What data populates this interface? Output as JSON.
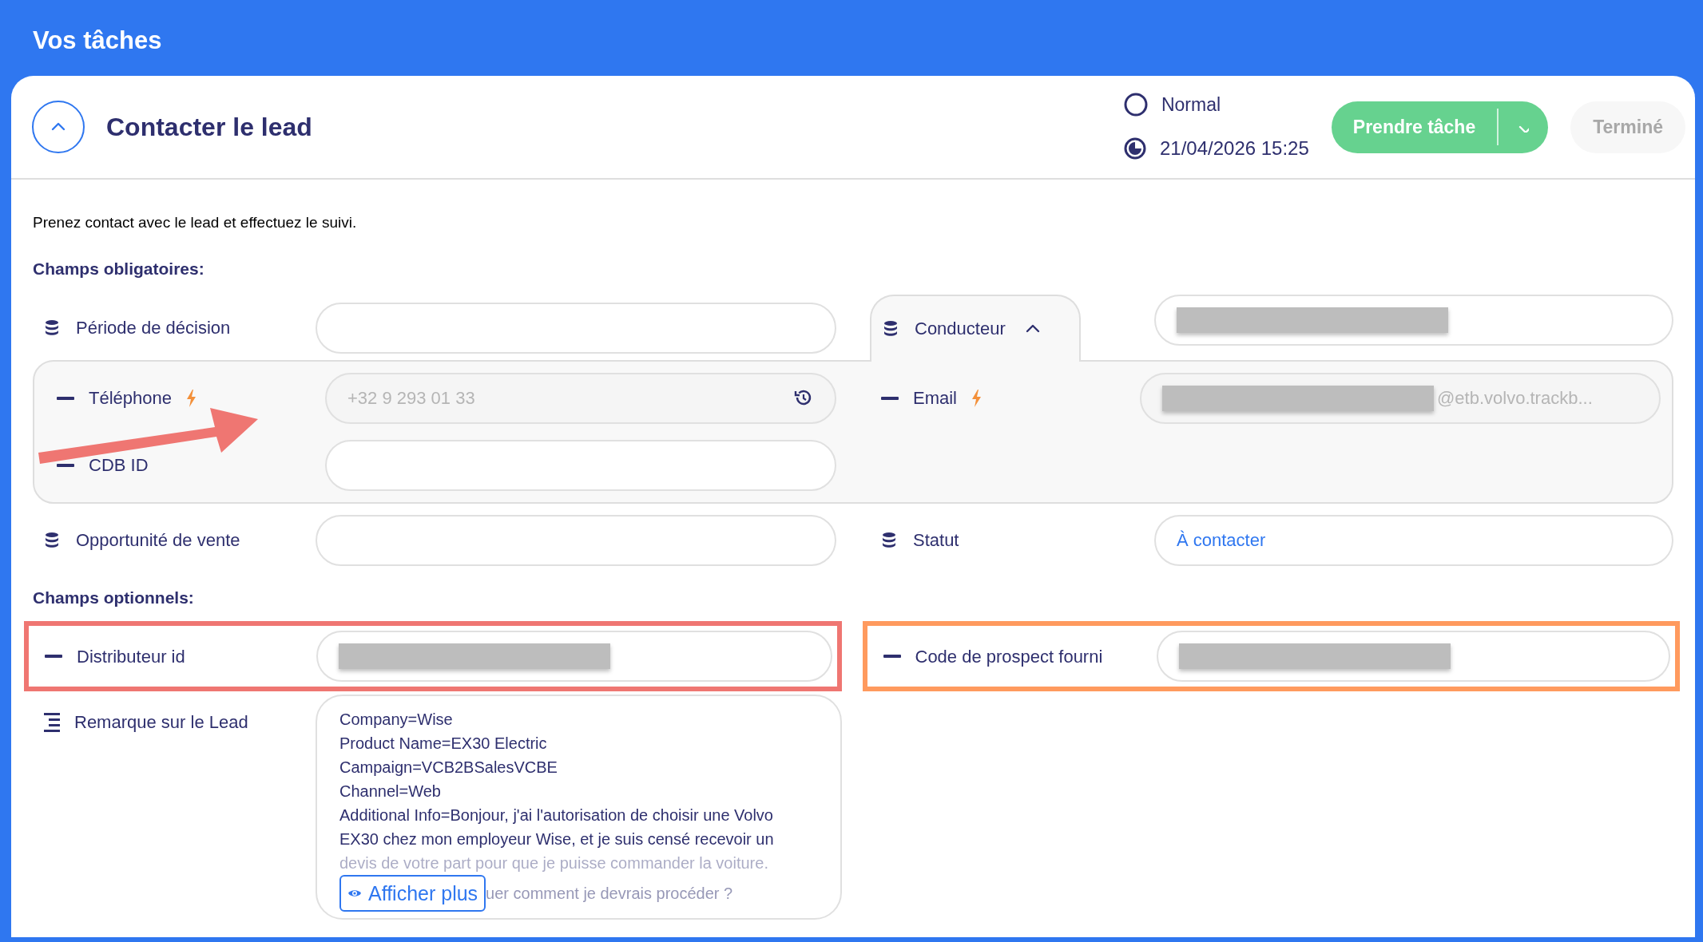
{
  "header": {
    "title": "Vos tâches"
  },
  "task": {
    "title": "Contacter le lead",
    "expanded": true,
    "priority": "Normal",
    "due": "21/04/2026 15:25",
    "primary_button": "Prendre tâche",
    "done_button": {
      "label": "Terminé",
      "disabled": true
    }
  },
  "description": "Prenez contact avec le lead et effectuez le suivi.",
  "required": {
    "title": "Champs obligatoires:",
    "rows": [
      {
        "kind": "pair",
        "left": {
          "kind": "linked",
          "label": "Période de décision"
        },
        "right": {
          "kind": "linked",
          "label": "Conducteur",
          "expanded": true,
          "redacted": true
        }
      },
      {
        "kind": "group",
        "left": [
          {
            "kind": "sub",
            "label": "Téléphone",
            "lightning": true,
            "readonly": true,
            "value": "+32 9 293 01 33",
            "history": true
          },
          {
            "kind": "sub",
            "label": "CDB ID"
          }
        ],
        "right": [
          {
            "kind": "sub",
            "label": "Email",
            "lightning": true,
            "readonly": true,
            "redacted": true,
            "value": "@etb.volvo.trackb..."
          }
        ]
      },
      {
        "kind": "pair",
        "left": {
          "kind": "linked",
          "label": "Opportunité de vente"
        },
        "right": {
          "kind": "linked",
          "label": "Statut",
          "value": "À contacter",
          "link": true
        }
      }
    ]
  },
  "optional": {
    "title": "Champs optionnels:",
    "rows": [
      {
        "kind": "pair",
        "left": {
          "kind": "sub",
          "label": "Distributeur id",
          "redacted": true,
          "color": "#ef7672"
        },
        "right": {
          "kind": "sub",
          "label": "Code de prospect fourni",
          "redacted": true,
          "color": "#ff9a5e"
        }
      },
      {
        "kind": "note",
        "label": "Remarque sur le Lead",
        "lines": [
          {
            "text": "Company=Wise",
            "faded": false
          },
          {
            "text": "Product Name=EX30 Electric",
            "faded": false
          },
          {
            "text": "Campaign=VCB2BSalesVCBE",
            "faded": false
          },
          {
            "text": "Channel=Web",
            "faded": false
          },
          {
            "text": "Additional Info=Bonjour, j'ai l'autorisation de choisir une Volvo",
            "faded": false
          },
          {
            "text": "EX30 chez mon employeur Wise, et je suis censé recevoir un",
            "faded": false
          },
          {
            "text": "devis de votre part pour que je puisse commander la voiture.",
            "faded": true
          }
        ],
        "more_button": "Afficher plus",
        "after_button": "uer comment je devrais procéder ?"
      }
    ]
  },
  "annotations": [
    {
      "kind": "arrow",
      "color": "#ef7672"
    }
  ]
}
